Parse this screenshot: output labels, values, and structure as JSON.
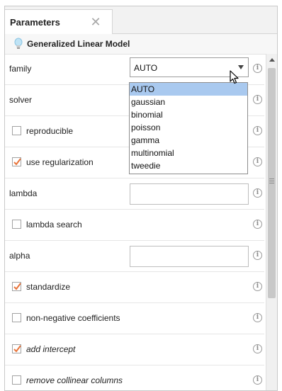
{
  "tab": {
    "label": "Parameters",
    "close_icon": "close-icon"
  },
  "model": {
    "title": "Generalized Linear Model",
    "icon": "lightbulb-icon"
  },
  "fields": {
    "family": {
      "label": "family",
      "value": "AUTO"
    },
    "solver": {
      "label": "solver"
    },
    "reproducible": {
      "label": "reproducible",
      "checked": false
    },
    "use_regularization": {
      "label": "use regularization",
      "checked": true
    },
    "lambda": {
      "label": "lambda",
      "value": ""
    },
    "lambda_search": {
      "label": "lambda search",
      "checked": false
    },
    "alpha": {
      "label": "alpha",
      "value": ""
    },
    "standardize": {
      "label": "standardize",
      "checked": true
    },
    "non_negative_coefficients": {
      "label": "non-negative coefficients",
      "checked": false
    },
    "add_intercept": {
      "label": "add intercept",
      "checked": true
    },
    "remove_collinear_columns": {
      "label": "remove collinear columns",
      "checked": false
    }
  },
  "family_dropdown": {
    "options": [
      "AUTO",
      "gaussian",
      "binomial",
      "poisson",
      "gamma",
      "multinomial",
      "tweedie"
    ],
    "selected": "AUTO"
  },
  "colors": {
    "check": "#e8743b",
    "selection": "#a9c9ef"
  }
}
